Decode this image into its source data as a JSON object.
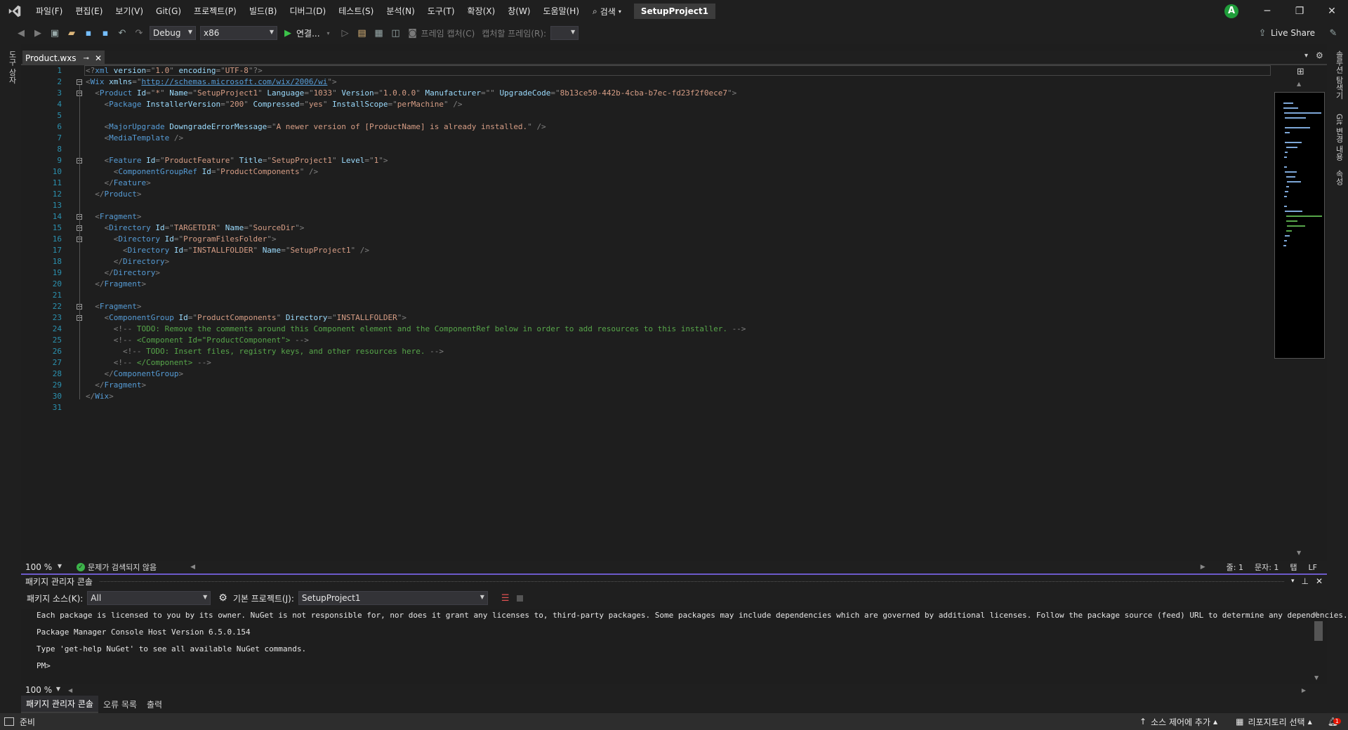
{
  "title_bar": {
    "menus": [
      "파일(F)",
      "편집(E)",
      "보기(V)",
      "Git(G)",
      "프로젝트(P)",
      "빌드(B)",
      "디버그(D)",
      "테스트(S)",
      "분석(N)",
      "도구(T)",
      "확장(X)",
      "창(W)",
      "도움말(H)"
    ],
    "search_label": "검색",
    "solution_name": "SetupProject1",
    "avatar_initial": "A"
  },
  "toolbar": {
    "configuration": "Debug",
    "platform": "x86",
    "run_label": "연결...",
    "capture_frame_label": "프레임 캡처(C)",
    "frame_to_capture_label": "캡처할 프레임(R):",
    "live_share_label": "Live Share"
  },
  "left_strip": {
    "toolbox_label": "도구 상자"
  },
  "right_strip": {
    "solution_explorer_label": "솔루션 탐색기",
    "git_changes_label": "Git 변경 내용",
    "properties_label": "속성"
  },
  "editor": {
    "tab_name": "Product.wxs",
    "line_numbers": [
      "1",
      "2",
      "3",
      "4",
      "5",
      "6",
      "7",
      "8",
      "9",
      "10",
      "11",
      "12",
      "13",
      "14",
      "15",
      "16",
      "17",
      "18",
      "19",
      "20",
      "21",
      "22",
      "23",
      "24",
      "25",
      "26",
      "27",
      "28",
      "29",
      "30",
      "31"
    ],
    "code": [
      "<?xml version=\"1.0\" encoding=\"UTF-8\"?>",
      "<Wix xmlns=\"http://schemas.microsoft.com/wix/2006/wi\">",
      "  <Product Id=\"*\" Name=\"SetupProject1\" Language=\"1033\" Version=\"1.0.0.0\" Manufacturer=\"\" UpgradeCode=\"8b13ce50-442b-4cba-b7ec-fd23f2f0ece7\">",
      "    <Package InstallerVersion=\"200\" Compressed=\"yes\" InstallScope=\"perMachine\" />",
      "",
      "    <MajorUpgrade DowngradeErrorMessage=\"A newer version of [ProductName] is already installed.\" />",
      "    <MediaTemplate />",
      "",
      "    <Feature Id=\"ProductFeature\" Title=\"SetupProject1\" Level=\"1\">",
      "      <ComponentGroupRef Id=\"ProductComponents\" />",
      "    </Feature>",
      "  </Product>",
      "",
      "  <Fragment>",
      "    <Directory Id=\"TARGETDIR\" Name=\"SourceDir\">",
      "      <Directory Id=\"ProgramFilesFolder\">",
      "        <Directory Id=\"INSTALLFOLDER\" Name=\"SetupProject1\" />",
      "      </Directory>",
      "    </Directory>",
      "  </Fragment>",
      "",
      "  <Fragment>",
      "    <ComponentGroup Id=\"ProductComponents\" Directory=\"INSTALLFOLDER\">",
      "      <!-- TODO: Remove the comments around this Component element and the ComponentRef below in order to add resources to this installer. -->",
      "      <!-- <Component Id=\"ProductComponent\"> -->",
      "        <!-- TODO: Insert files, registry keys, and other resources here. -->",
      "      <!-- </Component> -->",
      "    </ComponentGroup>",
      "  </Fragment>",
      "</Wix>",
      ""
    ],
    "zoom": "100 %",
    "issues_label": "문제가 검색되지 않음",
    "line_label": "줄: 1",
    "char_label": "문자: 1",
    "indent_label": "탭",
    "eol_label": "LF"
  },
  "package_console": {
    "title": "패키지 관리자 콘솔",
    "source_label": "패키지 소스(K):",
    "source_value": "All",
    "default_project_label": "기본 프로젝트(J):",
    "default_project_value": "SetupProject1",
    "output_lines": [
      "Each package is licensed to you by its owner. NuGet is not responsible for, nor does it grant any licenses to, third-party packages. Some packages may include dependencies which are governed by additional licenses. Follow the package source (feed) URL to determine any dependencies.",
      "",
      "Package Manager Console Host Version 6.5.0.154",
      "",
      "Type 'get-help NuGet' to see all available NuGet commands.",
      "",
      "PM>"
    ],
    "zoom": "100 %"
  },
  "bottom_tabs": [
    "패키지 관리자 콘솔",
    "오류 목록",
    "출력"
  ],
  "status_bar": {
    "ready": "준비",
    "source_control": "소스 제어에 추가",
    "repository": "리포지토리 선택",
    "notification_count": "1"
  },
  "colors": {
    "accent": "#6c5ac9",
    "tag": "#569cd6",
    "attr": "#9cdcfe",
    "value": "#d69d85",
    "comment": "#57a64a"
  }
}
